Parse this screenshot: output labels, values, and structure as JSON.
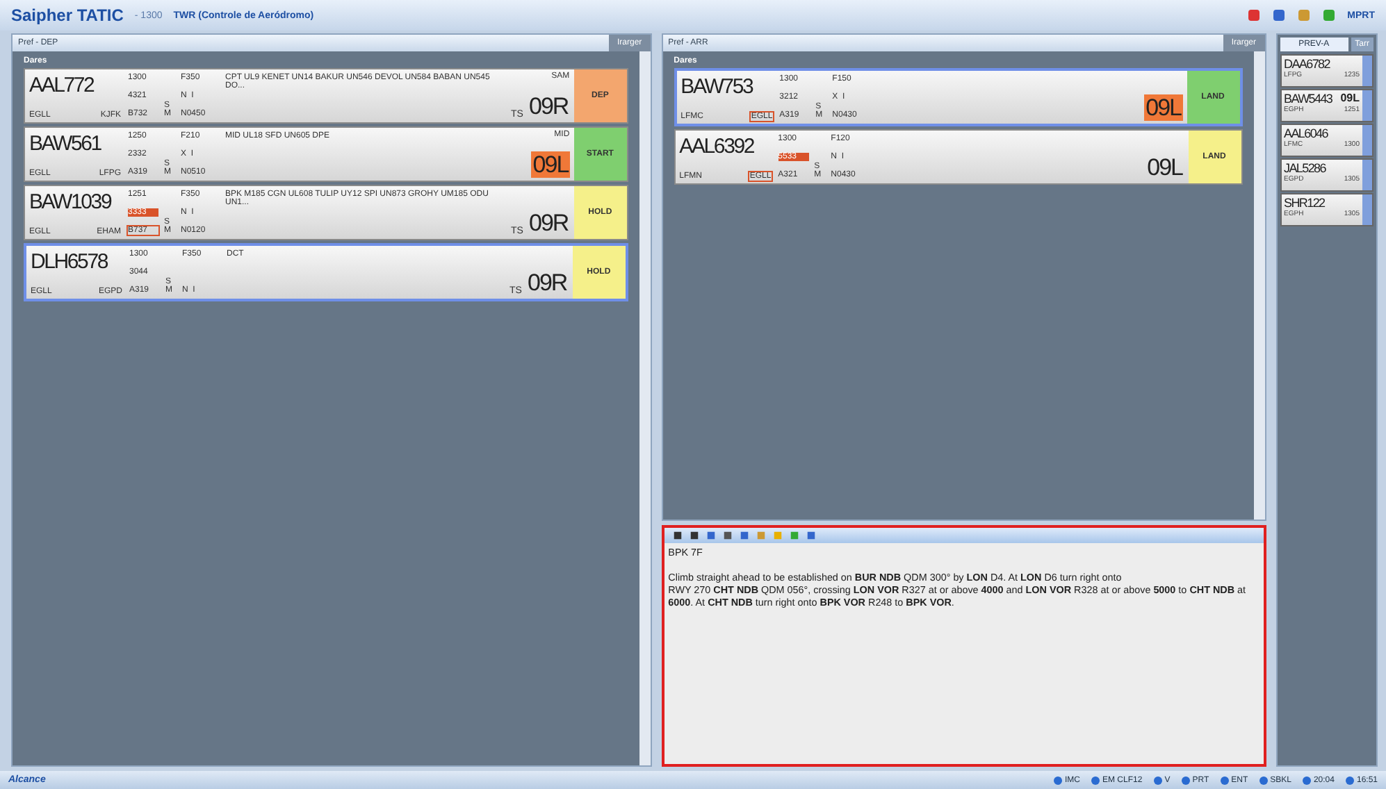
{
  "app": {
    "title": "Saipher TATIC",
    "version": "- 1300",
    "position": "TWR (Controle de Aeródromo)",
    "user": "MPRT"
  },
  "left_panel": {
    "title": "Pref - DEP",
    "button": "Irarger",
    "section": "Dares",
    "strips": [
      {
        "callsign": "AAL772",
        "origin": {
          "text": "EGLL"
        },
        "destination": {
          "text": "KJFK"
        },
        "c1": [
          {
            "text": "1300"
          },
          {
            "text": "4321"
          },
          {
            "text": "B732"
          }
        ],
        "c2": [
          {
            "text": "S"
          },
          {
            "text": "M"
          }
        ],
        "c3": [
          {
            "text": "F350"
          },
          {
            "text": "N  I"
          },
          {
            "text": "N0450"
          }
        ],
        "route": "CPT UL9 KENET UN14 BAKUR UN546 DEVOL UN584 BABAN UN545 DO...",
        "sid": "SAM",
        "ts": "TS",
        "runway": "09R",
        "runway_alert": false,
        "status": {
          "label": "DEP",
          "color": "#f3a66e"
        },
        "selected": false
      },
      {
        "callsign": "BAW561",
        "origin": {
          "text": "EGLL"
        },
        "destination": {
          "text": "LFPG"
        },
        "c1": [
          {
            "text": "1250"
          },
          {
            "text": "2332"
          },
          {
            "text": "A319"
          }
        ],
        "c2": [
          {
            "text": "S"
          },
          {
            "text": "M"
          }
        ],
        "c3": [
          {
            "text": "F210"
          },
          {
            "text": "X  I"
          },
          {
            "text": "N0510"
          }
        ],
        "route": "MID UL18 SFD UN605 DPE",
        "sid": "MID",
        "runway": "09L",
        "runway_alert": true,
        "status": {
          "label": "START",
          "color": "#7fcf6f"
        },
        "selected": false
      },
      {
        "callsign": "BAW1039",
        "origin": {
          "text": "EGLL"
        },
        "destination": {
          "text": "EHAM"
        },
        "c1": [
          {
            "text": "1251"
          },
          {
            "text": "3333",
            "alert": true
          },
          {
            "text": "B737",
            "outlined": true
          }
        ],
        "c2": [
          {
            "text": "S"
          },
          {
            "text": "M"
          }
        ],
        "c3": [
          {
            "text": "F350"
          },
          {
            "text": "N  I"
          },
          {
            "text": "N0120"
          }
        ],
        "route": "BPK M185 CGN UL608 TULIP UY12 SPI UN873 GROHY UM185 ODU UN1...",
        "ts": "TS",
        "runway": "09R",
        "runway_alert": false,
        "status": {
          "label": "HOLD",
          "color": "#f5f08a"
        },
        "selected": false
      },
      {
        "callsign": "DLH6578",
        "origin": {
          "text": "EGLL"
        },
        "destination": {
          "text": "EGPD"
        },
        "c1": [
          {
            "text": "1300"
          },
          {
            "text": "3044"
          },
          {
            "text": "A319"
          }
        ],
        "c2": [
          {
            "text": "S"
          },
          {
            "text": "M"
          }
        ],
        "c3": [
          {
            "text": "F350"
          },
          {
            "text": "N  I"
          }
        ],
        "route": "DCT",
        "ts": "TS",
        "runway": "09R",
        "runway_alert": false,
        "status": {
          "label": "HOLD",
          "color": "#f5f08a"
        },
        "selected": true
      }
    ]
  },
  "middle_panel": {
    "title": "Pref - ARR",
    "button": "Irarger",
    "section": "Dares",
    "strips": [
      {
        "callsign": "BAW753",
        "origin": {
          "text": "LFMC"
        },
        "destination": {
          "text": "EGLL",
          "outlined": true
        },
        "c1": [
          {
            "text": "1300"
          },
          {
            "text": "3212"
          },
          {
            "text": "A319"
          }
        ],
        "c2": [
          {
            "text": "S"
          },
          {
            "text": "M"
          }
        ],
        "c3": [
          {
            "text": "F150"
          },
          {
            "text": "X  I"
          },
          {
            "text": "N0430"
          }
        ],
        "runway": "09L",
        "runway_alert": true,
        "status": {
          "label": "LAND",
          "color": "#7fcf6f"
        },
        "selected": true
      },
      {
        "callsign": "AAL6392",
        "origin": {
          "text": "LFMN"
        },
        "destination": {
          "text": "EGLL",
          "outlined": true
        },
        "c1": [
          {
            "text": "1300"
          },
          {
            "text": "5533",
            "alert": true
          },
          {
            "text": "A321"
          }
        ],
        "c2": [
          {
            "text": "S"
          },
          {
            "text": "M"
          }
        ],
        "c3": [
          {
            "text": "F120"
          },
          {
            "text": "N  I"
          },
          {
            "text": "N0430"
          }
        ],
        "runway": "09L",
        "runway_alert": false,
        "status": {
          "label": "LAND",
          "color": "#f5f08a"
        },
        "selected": false
      }
    ]
  },
  "side_panel": {
    "tabs": [
      {
        "label": "PREV-A",
        "selected": true
      },
      {
        "label": "Tarr",
        "selected": false
      }
    ],
    "strips": [
      {
        "callsign": "DAA6782",
        "line": [
          "LFPG",
          "1235"
        ]
      },
      {
        "callsign": "BAW5443",
        "tag": "09L",
        "line": [
          "EGPH",
          "1251"
        ]
      },
      {
        "callsign": "AAL6046",
        "line": [
          "LFMC",
          "1300"
        ]
      },
      {
        "callsign": "JAL5286",
        "line": [
          "EGPD",
          "1305"
        ]
      },
      {
        "callsign": "SHR122",
        "line": [
          "EGPH",
          "1305"
        ]
      }
    ]
  },
  "editor": {
    "heading": "BPK 7F",
    "lines": [
      "Climb straight ahead to be established on **BUR NDB** QDM 300° by **LON** D4. At **LON** D6 turn right onto",
      "RWY 270 **CHT NDB** QDM 056°, crossing **LON VOR** R327 at or above **4000** and **LON VOR** R328 at or above **5000** to **CHT NDB** at",
      "**6000**. At **CHT NDB** turn right onto **BPK VOR** R248 to **BPK VOR**."
    ]
  },
  "status_bar": {
    "left": "Alcance",
    "right": [
      "IMC",
      "EM CLF12",
      "V",
      "PRT",
      "ENT",
      "SBKL",
      "20:04",
      "16:51"
    ]
  }
}
